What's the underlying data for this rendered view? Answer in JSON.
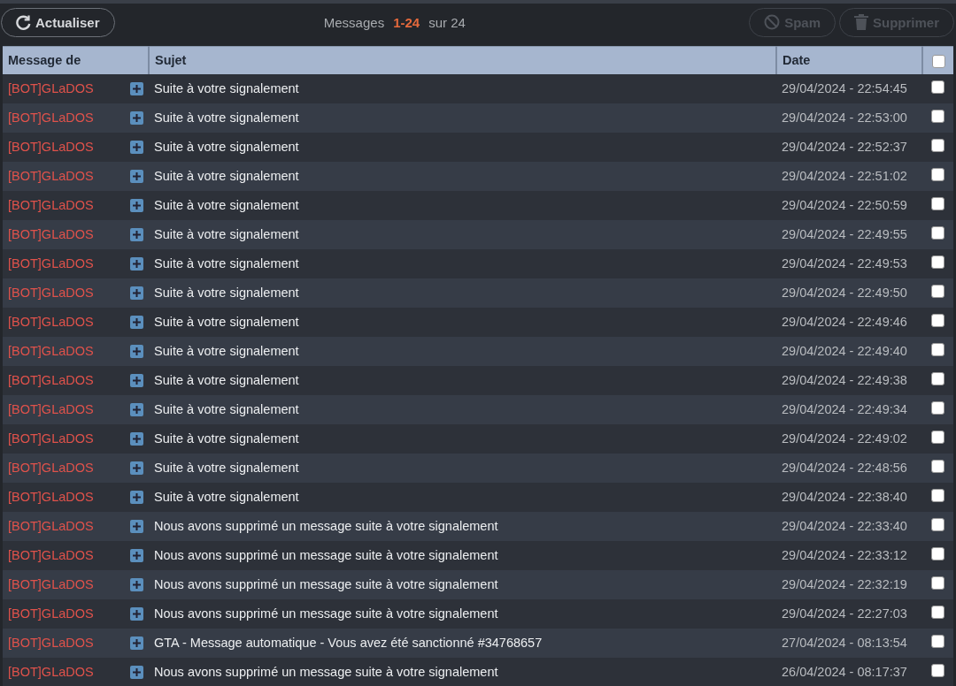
{
  "toolbar": {
    "refresh_button": "Actualiser",
    "summary": {
      "prefix": "Messages",
      "range": "1-24",
      "suffix": "sur 24"
    },
    "actions": [
      {
        "kind": "spam",
        "label": "Spam",
        "disabled": true
      },
      {
        "kind": "delete",
        "label": "Supprimer",
        "disabled": true
      }
    ]
  },
  "table": {
    "columns": [
      "Message de",
      "Sujet",
      "Date"
    ],
    "select_all_checked": false,
    "rows": [
      {
        "from": "[BOT]GLaDOS",
        "subject": "Suite à votre signalement",
        "date": "29/04/2024 - 22:54:45",
        "checked": false
      },
      {
        "from": "[BOT]GLaDOS",
        "subject": "Suite à votre signalement",
        "date": "29/04/2024 - 22:53:00",
        "checked": false
      },
      {
        "from": "[BOT]GLaDOS",
        "subject": "Suite à votre signalement",
        "date": "29/04/2024 - 22:52:37",
        "checked": false
      },
      {
        "from": "[BOT]GLaDOS",
        "subject": "Suite à votre signalement",
        "date": "29/04/2024 - 22:51:02",
        "checked": false
      },
      {
        "from": "[BOT]GLaDOS",
        "subject": "Suite à votre signalement",
        "date": "29/04/2024 - 22:50:59",
        "checked": false
      },
      {
        "from": "[BOT]GLaDOS",
        "subject": "Suite à votre signalement",
        "date": "29/04/2024 - 22:49:55",
        "checked": false
      },
      {
        "from": "[BOT]GLaDOS",
        "subject": "Suite à votre signalement",
        "date": "29/04/2024 - 22:49:53",
        "checked": false
      },
      {
        "from": "[BOT]GLaDOS",
        "subject": "Suite à votre signalement",
        "date": "29/04/2024 - 22:49:50",
        "checked": false
      },
      {
        "from": "[BOT]GLaDOS",
        "subject": "Suite à votre signalement",
        "date": "29/04/2024 - 22:49:46",
        "checked": false
      },
      {
        "from": "[BOT]GLaDOS",
        "subject": "Suite à votre signalement",
        "date": "29/04/2024 - 22:49:40",
        "checked": false
      },
      {
        "from": "[BOT]GLaDOS",
        "subject": "Suite à votre signalement",
        "date": "29/04/2024 - 22:49:38",
        "checked": false
      },
      {
        "from": "[BOT]GLaDOS",
        "subject": "Suite à votre signalement",
        "date": "29/04/2024 - 22:49:34",
        "checked": false
      },
      {
        "from": "[BOT]GLaDOS",
        "subject": "Suite à votre signalement",
        "date": "29/04/2024 - 22:49:02",
        "checked": false
      },
      {
        "from": "[BOT]GLaDOS",
        "subject": "Suite à votre signalement",
        "date": "29/04/2024 - 22:48:56",
        "checked": false
      },
      {
        "from": "[BOT]GLaDOS",
        "subject": "Suite à votre signalement",
        "date": "29/04/2024 - 22:38:40",
        "checked": false
      },
      {
        "from": "[BOT]GLaDOS",
        "subject": "Nous avons supprimé un message suite à votre signalement",
        "date": "29/04/2024 - 22:33:40",
        "checked": false
      },
      {
        "from": "[BOT]GLaDOS",
        "subject": "Nous avons supprimé un message suite à votre signalement",
        "date": "29/04/2024 - 22:33:12",
        "checked": false
      },
      {
        "from": "[BOT]GLaDOS",
        "subject": "Nous avons supprimé un message suite à votre signalement",
        "date": "29/04/2024 - 22:32:19",
        "checked": false
      },
      {
        "from": "[BOT]GLaDOS",
        "subject": "Nous avons supprimé un message suite à votre signalement",
        "date": "29/04/2024 - 22:27:03",
        "checked": false
      },
      {
        "from": "[BOT]GLaDOS",
        "subject": "GTA - Message automatique - Vous avez été sanctionné #34768657",
        "date": "27/04/2024 - 08:13:54",
        "checked": false
      },
      {
        "from": "[BOT]GLaDOS",
        "subject": "Nous avons supprimé un message suite à votre signalement",
        "date": "26/04/2024 - 08:17:37",
        "checked": false
      }
    ]
  }
}
